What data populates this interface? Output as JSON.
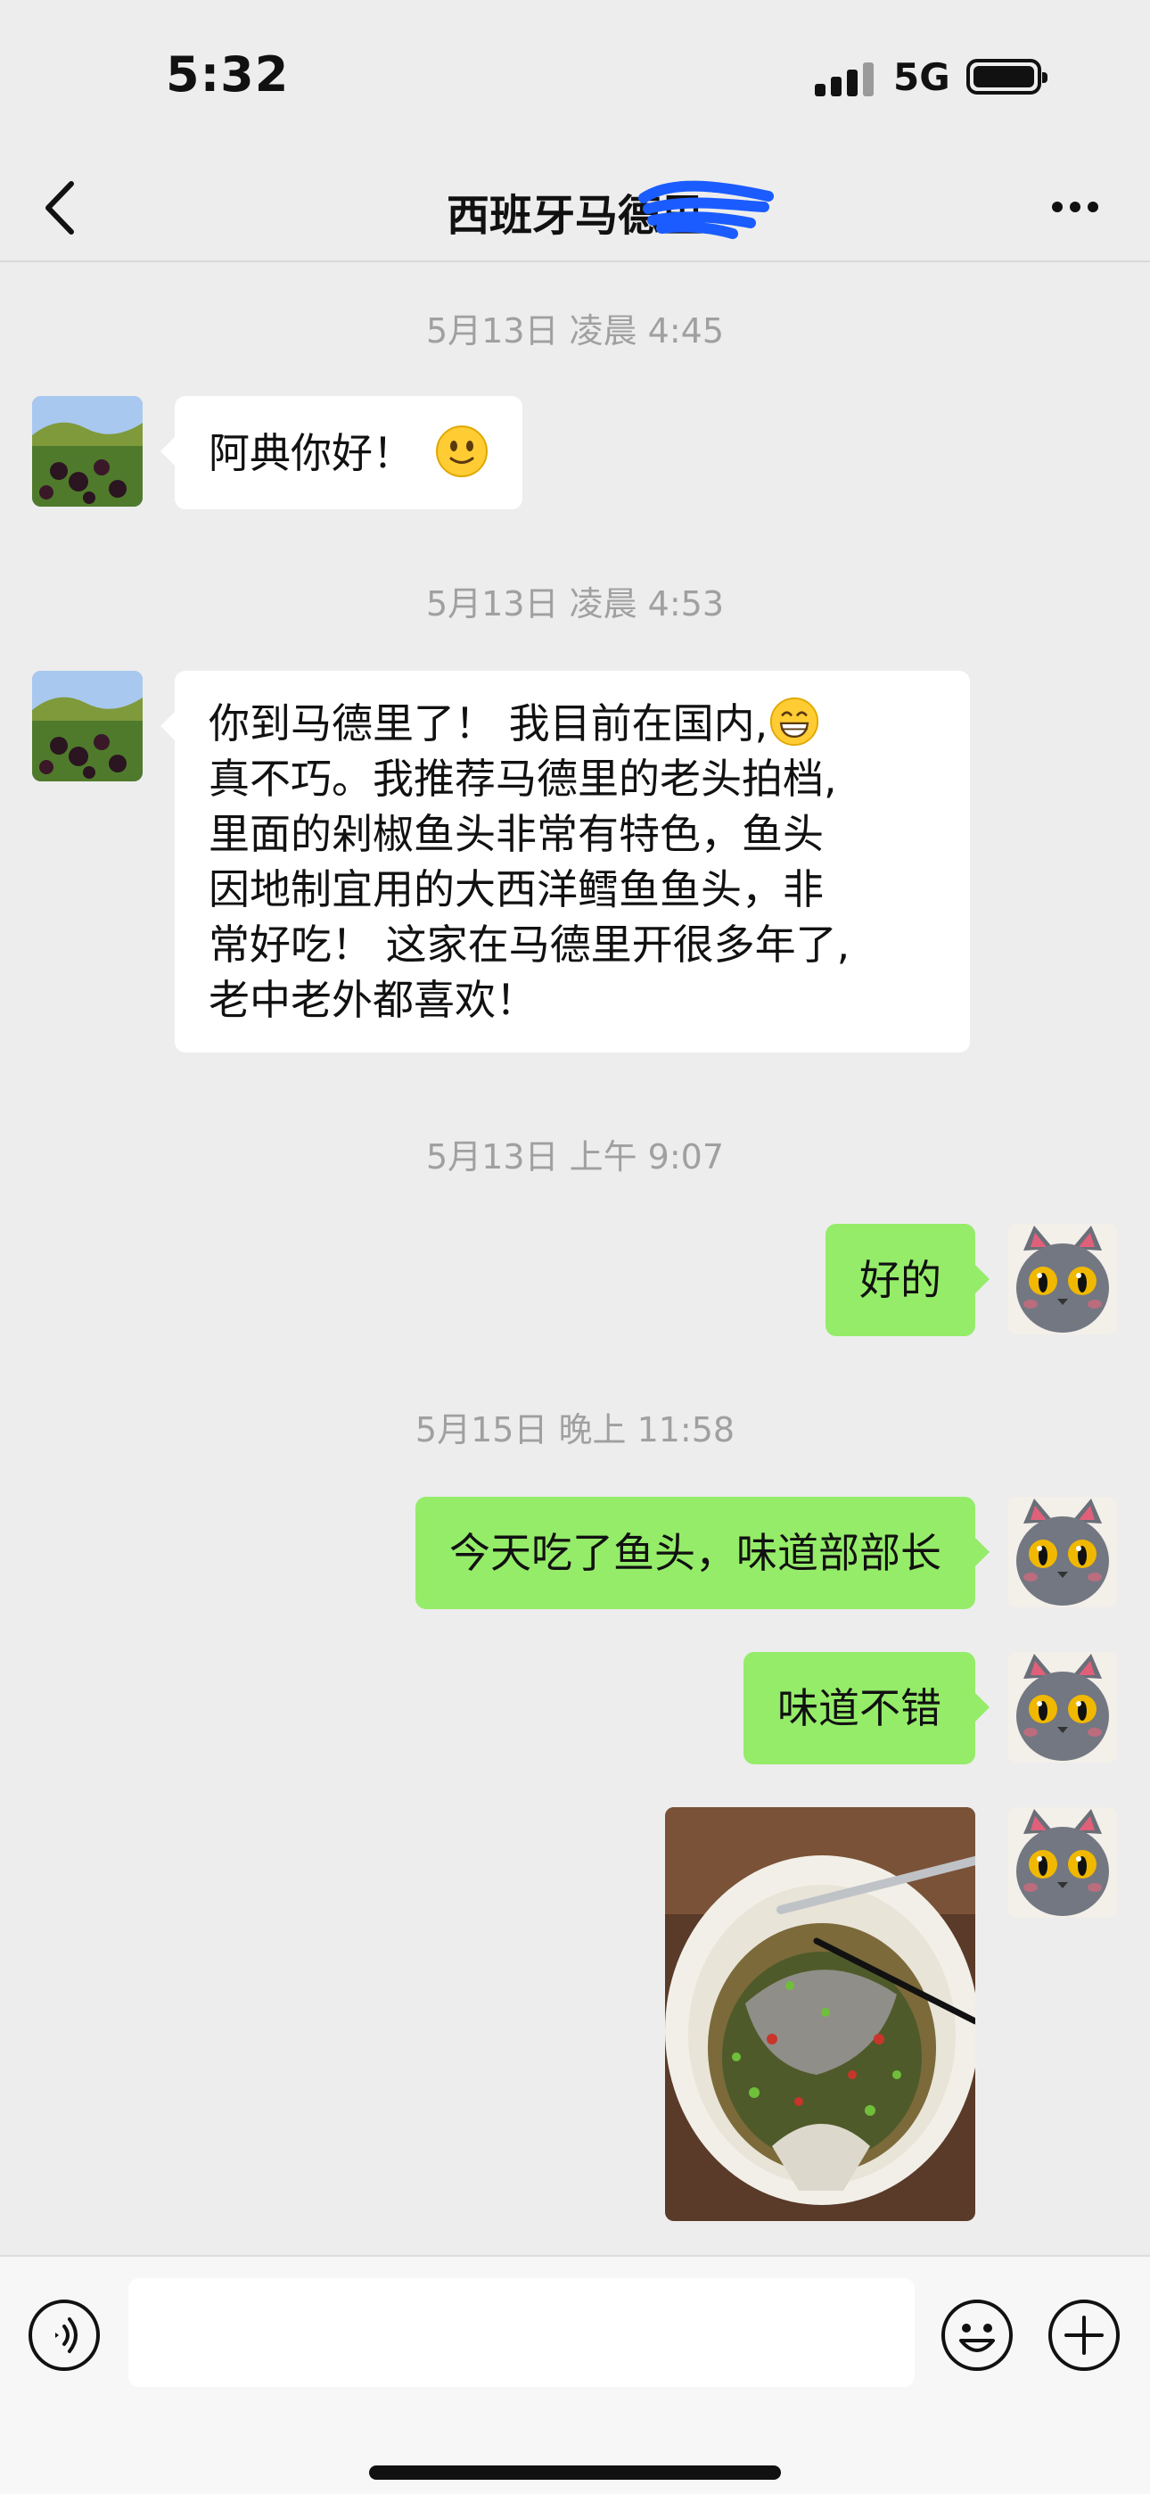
{
  "status_bar": {
    "time": "5:32",
    "network": "5G"
  },
  "header": {
    "title": "西班牙马德里",
    "more_icon": "more-icon",
    "back_icon": "back-icon"
  },
  "messages": [
    {
      "timestamp": "5月13日 凌晨 4:45"
    },
    {
      "side": "left",
      "text": "阿典你好！",
      "emoji": "smile-emoji"
    },
    {
      "timestamp": "5月13日 凌晨 4:53"
    },
    {
      "side": "left",
      "lines": [
        "你到马德里了！ 我目前在国内,",
        "真不巧。我推荐马德里的老头拍档,",
        "里面的剁椒鱼头非常有特色，鱼头",
        "因地制宜用的大西洋鳕鱼鱼头，非",
        "常好吃！ 这家在马德里开很多年了,",
        "老中老外都喜欢！"
      ]
    },
    {
      "timestamp": "5月13日 上午 9:07"
    },
    {
      "side": "right",
      "text": "好的"
    },
    {
      "timestamp": "5月15日 晚上 11:58"
    },
    {
      "side": "right",
      "text": "今天吃了鱼头，味道部部长"
    },
    {
      "side": "right",
      "text": "味道不错"
    },
    {
      "side": "right",
      "type": "image",
      "image": "fish-head-photo"
    }
  ],
  "colors": {
    "background": "#ededed",
    "bubble_self": "#95ec69",
    "bubble_other": "#ffffff",
    "timestamp": "#a0a0a0"
  },
  "input_bar": {
    "voice_icon": "voice-icon",
    "emoji_icon": "emoji-icon",
    "plus_icon": "plus-icon",
    "placeholder": ""
  }
}
